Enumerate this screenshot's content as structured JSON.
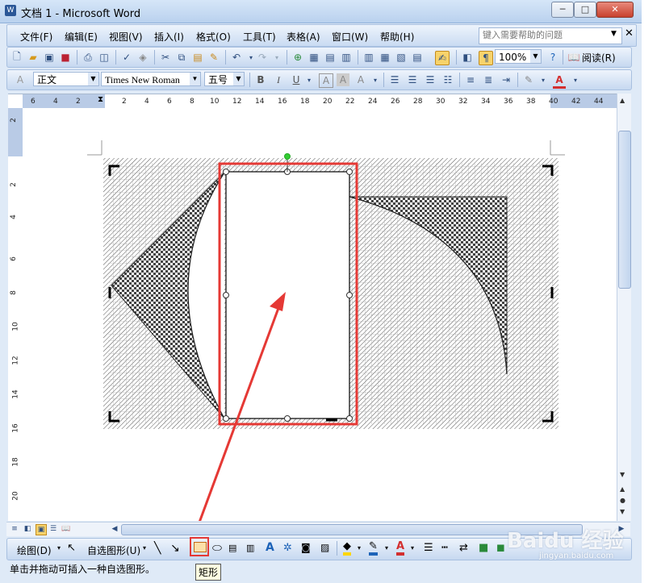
{
  "window": {
    "title": "文档 1 - Microsoft Word",
    "app_icon": "W",
    "min": "─",
    "max": "□",
    "close": "✕"
  },
  "menu": {
    "items": [
      "文件(F)",
      "编辑(E)",
      "视图(V)",
      "插入(I)",
      "格式(O)",
      "工具(T)",
      "表格(A)",
      "窗口(W)",
      "帮助(H)"
    ],
    "help_search_placeholder": "键入需要帮助的问题"
  },
  "standard_toolbar": {
    "zoom": "100%",
    "read_label": "阅读(R)"
  },
  "format_toolbar": {
    "style": "正文",
    "font": "Times New Roman",
    "size": "五号",
    "bold": "B",
    "italic": "I",
    "underline": "U"
  },
  "ruler": {
    "h_labels": [
      "6",
      "4",
      "2",
      "2",
      "4",
      "6",
      "8",
      "10",
      "12",
      "14",
      "16",
      "18",
      "20",
      "22",
      "24",
      "26",
      "28",
      "30",
      "32",
      "34",
      "36",
      "38",
      "40",
      "42",
      "44"
    ],
    "v_labels": [
      "2",
      "2",
      "4",
      "6",
      "8",
      "10",
      "12",
      "14",
      "16",
      "18",
      "20"
    ]
  },
  "drawing_toolbar": {
    "draw_label": "绘图(D)",
    "autoshape_label": "自选图形(U)",
    "rect_tooltip": "矩形"
  },
  "status": {
    "text": "单击并拖动可插入一种自选图形。"
  },
  "watermark": {
    "brand": "Baidu 经验",
    "url": "jingyan.baidu.com"
  },
  "colors": {
    "highlight_red": "#e53935",
    "grid": "#b8b8b8",
    "accent_blue": "#2b5797"
  }
}
